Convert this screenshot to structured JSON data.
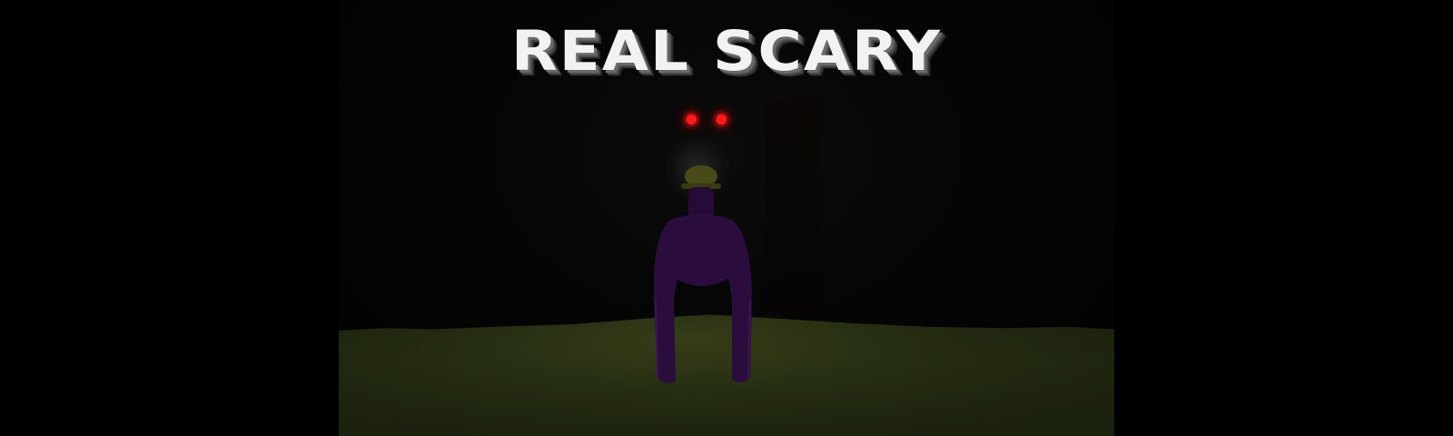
{
  "title": "REAL SCARY",
  "colors": {
    "background": "#000000",
    "title_text": "#f2f2f2",
    "eyes": "#ff1a1a",
    "creature_body": "#2a0d3d",
    "helmet": "#4a4a18",
    "ground": "#232b12"
  },
  "icons": {
    "creature": "purple-gorilla-icon",
    "eyes": "red-glowing-eyes-icon"
  }
}
